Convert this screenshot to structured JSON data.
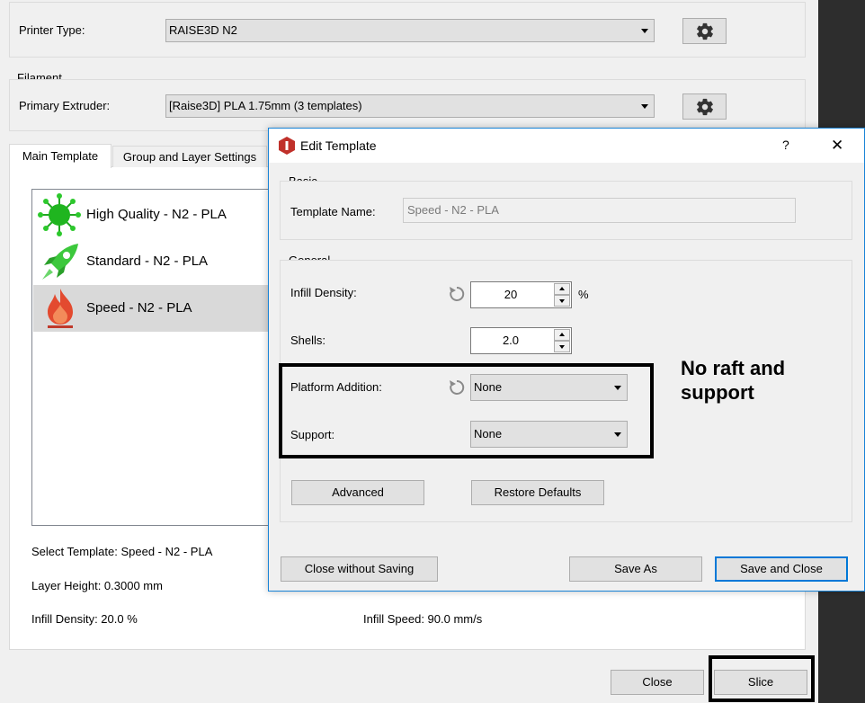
{
  "printer": {
    "label": "Printer Type:",
    "value": "RAISE3D N2"
  },
  "filament": {
    "group_title": "Filament",
    "label": "Primary Extruder:",
    "value": "[Raise3D] PLA 1.75mm (3 templates)"
  },
  "tabs": [
    {
      "label": "Main Template",
      "active": true
    },
    {
      "label": "Group and Layer Settings",
      "active": false
    }
  ],
  "templates": [
    {
      "name": "High Quality - N2 - PLA",
      "icon": "virus-icon",
      "selected": false
    },
    {
      "name": "Standard - N2 - PLA",
      "icon": "rocket-icon",
      "selected": false
    },
    {
      "name": "Speed - N2 - PLA",
      "icon": "flame-icon",
      "selected": true
    }
  ],
  "info": {
    "select_template": "Select Template: Speed - N2 - PLA",
    "layer_height": "Layer Height: 0.3000 mm",
    "infill_density": "Infill Density: 20.0 %",
    "infill_speed": "Infill Speed: 90.0 mm/s"
  },
  "bottom_buttons": {
    "close": "Close",
    "slice": "Slice"
  },
  "dialog": {
    "title": "Edit Template",
    "help_label": "?",
    "close_label": "✕",
    "basic": {
      "title": "Basic",
      "template_name_label": "Template Name:",
      "template_name_value": "Speed - N2 - PLA"
    },
    "general": {
      "title": "General",
      "infill_density_label": "Infill Density:",
      "infill_density_value": "20",
      "infill_density_unit": "%",
      "shells_label": "Shells:",
      "shells_value": "2.0",
      "platform_addition_label": "Platform Addition:",
      "platform_addition_value": "None",
      "support_label": "Support:",
      "support_value": "None",
      "advanced_button": "Advanced",
      "restore_defaults_button": "Restore Defaults"
    },
    "buttons": {
      "close_without_saving": "Close without Saving",
      "save_as": "Save As",
      "save_and_close": "Save and Close"
    }
  },
  "annotation": {
    "text": "No raft and support"
  },
  "colors": {
    "accent": "#0078d7",
    "selected_row": "#d9d9d9",
    "dialog_border": "#1883d7"
  }
}
